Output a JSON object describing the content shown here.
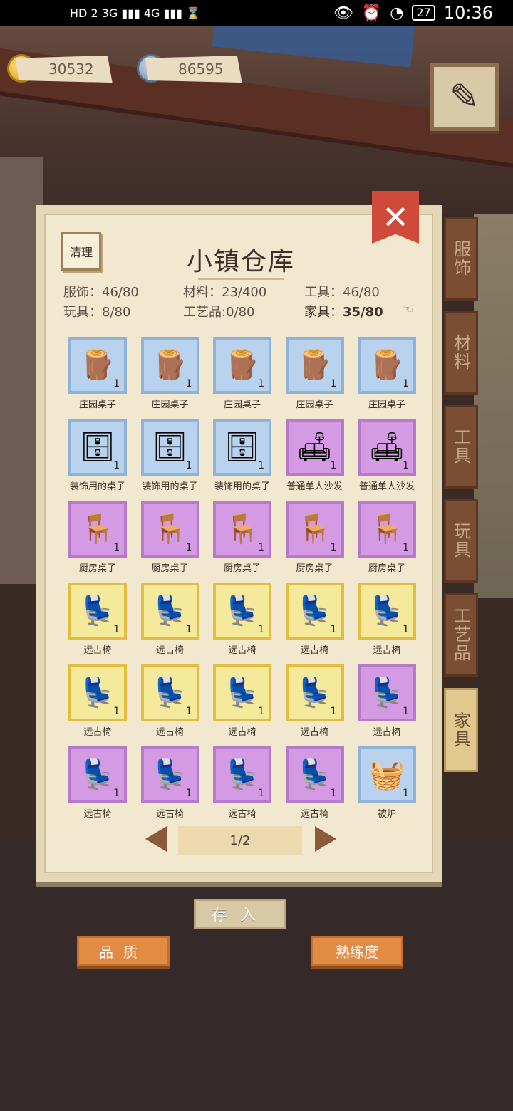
{
  "status_bar": {
    "left_text": "HD 2  3G ▮▮▮  4G ▮▮▮  ⌛",
    "battery": "27",
    "time": "10:36",
    "icons": [
      "eye-icon",
      "alarm-icon",
      "speedometer-icon",
      "battery-icon"
    ]
  },
  "currency": {
    "gold": "30532",
    "silver": "86595"
  },
  "panel": {
    "title": "小镇仓库",
    "clear_label": "清理",
    "close_label": "✕"
  },
  "tabs": [
    {
      "label": "服饰",
      "active": false
    },
    {
      "label": "材料",
      "active": false
    },
    {
      "label": "工具",
      "active": false
    },
    {
      "label": "玩具",
      "active": false
    },
    {
      "label": "工艺品",
      "active": false
    },
    {
      "label": "家具",
      "active": true
    }
  ],
  "stats": [
    {
      "label": "服饰：",
      "value": "46/80"
    },
    {
      "label": "材料：",
      "value": "23/400"
    },
    {
      "label": "工具：",
      "value": "46/80"
    },
    {
      "label": "玩具：",
      "value": "8/80"
    },
    {
      "label": "工艺品:",
      "value": "0/80"
    },
    {
      "label": "家具：",
      "value": "35/80"
    }
  ],
  "items": [
    {
      "name": "庄园桌子",
      "qty": "1",
      "rarity": "blue",
      "icon": "round-table-icon"
    },
    {
      "name": "庄园桌子",
      "qty": "1",
      "rarity": "blue",
      "icon": "round-table-icon"
    },
    {
      "name": "庄园桌子",
      "qty": "1",
      "rarity": "blue",
      "icon": "round-table-icon"
    },
    {
      "name": "庄园桌子",
      "qty": "1",
      "rarity": "blue",
      "icon": "round-table-icon"
    },
    {
      "name": "庄园桌子",
      "qty": "1",
      "rarity": "blue",
      "icon": "round-table-icon"
    },
    {
      "name": "装饰用的桌子",
      "qty": "1",
      "rarity": "blue",
      "icon": "desk-icon"
    },
    {
      "name": "装饰用的桌子",
      "qty": "1",
      "rarity": "blue",
      "icon": "desk-icon"
    },
    {
      "name": "装饰用的桌子",
      "qty": "1",
      "rarity": "blue",
      "icon": "desk-icon"
    },
    {
      "name": "普通单人沙发",
      "qty": "1",
      "rarity": "purple",
      "icon": "armchair-icon"
    },
    {
      "name": "普通单人沙发",
      "qty": "1",
      "rarity": "purple",
      "icon": "armchair-icon"
    },
    {
      "name": "厨房桌子",
      "qty": "1",
      "rarity": "purple",
      "icon": "kitchen-table-icon"
    },
    {
      "name": "厨房桌子",
      "qty": "1",
      "rarity": "purple",
      "icon": "kitchen-table-icon"
    },
    {
      "name": "厨房桌子",
      "qty": "1",
      "rarity": "purple",
      "icon": "kitchen-table-icon"
    },
    {
      "name": "厨房桌子",
      "qty": "1",
      "rarity": "purple",
      "icon": "kitchen-table-icon"
    },
    {
      "name": "厨房桌子",
      "qty": "1",
      "rarity": "purple",
      "icon": "kitchen-table-icon"
    },
    {
      "name": "远古椅",
      "qty": "1",
      "rarity": "yellow",
      "icon": "ancient-chair-icon"
    },
    {
      "name": "远古椅",
      "qty": "1",
      "rarity": "yellow",
      "icon": "ancient-chair-icon"
    },
    {
      "name": "远古椅",
      "qty": "1",
      "rarity": "yellow",
      "icon": "ancient-chair-icon"
    },
    {
      "name": "远古椅",
      "qty": "1",
      "rarity": "yellow",
      "icon": "ancient-chair-icon"
    },
    {
      "name": "远古椅",
      "qty": "1",
      "rarity": "yellow",
      "icon": "ancient-chair-icon"
    },
    {
      "name": "远古椅",
      "qty": "1",
      "rarity": "yellow",
      "icon": "ancient-chair-icon"
    },
    {
      "name": "远古椅",
      "qty": "1",
      "rarity": "yellow",
      "icon": "ancient-chair-icon"
    },
    {
      "name": "远古椅",
      "qty": "1",
      "rarity": "yellow",
      "icon": "ancient-chair-icon"
    },
    {
      "name": "远古椅",
      "qty": "1",
      "rarity": "yellow",
      "icon": "ancient-chair-icon"
    },
    {
      "name": "远古椅",
      "qty": "1",
      "rarity": "purple",
      "icon": "ancient-chair-icon"
    },
    {
      "name": "远古椅",
      "qty": "1",
      "rarity": "purple",
      "icon": "ancient-chair-icon"
    },
    {
      "name": "远古椅",
      "qty": "1",
      "rarity": "purple",
      "icon": "ancient-chair-icon"
    },
    {
      "name": "远古椅",
      "qty": "1",
      "rarity": "purple",
      "icon": "ancient-chair-icon"
    },
    {
      "name": "远古椅",
      "qty": "1",
      "rarity": "purple",
      "icon": "ancient-chair-icon"
    },
    {
      "name": "被炉",
      "qty": "1",
      "rarity": "blue",
      "icon": "kotatsu-icon"
    }
  ],
  "pagination": {
    "page": "1/2"
  },
  "buttons": {
    "store": "存入",
    "quality": "品质",
    "proficiency": "熟练度"
  },
  "colors": {
    "blue_slot": "#b9d2ee",
    "purple_slot": "#d49ae3",
    "yellow_slot": "#f5ea9c",
    "orange_button": "#e28b45",
    "close_red": "#cf4a3b"
  }
}
